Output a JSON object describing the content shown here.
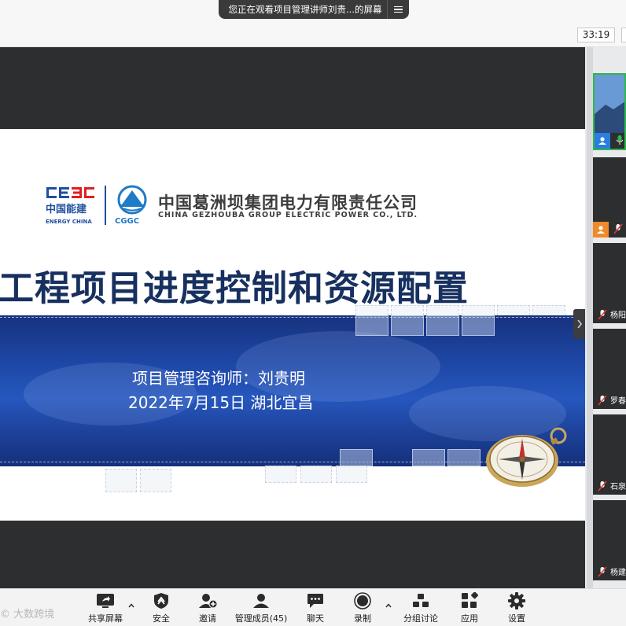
{
  "share_banner": {
    "text": "您正在观看项目管理讲师刘贵...的屏幕"
  },
  "timer": {
    "value": "33:19"
  },
  "slide": {
    "logo_left_text": "中国能建",
    "logo_left_sub": "ENERGY CHINA",
    "logo_right_text": "CGGC",
    "company_cn": "中国葛洲坝集团电力有限责任公司",
    "company_en": "CHINA GEZHOUBA GROUP ELECTRIC POWER CO., LTD.",
    "title": "工程项目进度控制和资源配置",
    "presenter": "项目管理咨询师：刘贵明",
    "date_location": "2022年7月15日 湖北宜昌"
  },
  "participants": [
    {
      "name": "",
      "role": "host",
      "mic": "on",
      "active": true
    },
    {
      "name": "",
      "role": "cohost",
      "mic": "muted",
      "active": false
    },
    {
      "name": "杨阳",
      "role": "",
      "mic": "muted",
      "active": false
    },
    {
      "name": "罗春",
      "role": "",
      "mic": "muted",
      "active": false
    },
    {
      "name": "石泉",
      "role": "",
      "mic": "muted",
      "active": false
    },
    {
      "name": "杨建",
      "role": "",
      "mic": "muted",
      "active": false
    }
  ],
  "toolbar": {
    "share_screen": "共享屏幕",
    "security": "安全",
    "invite": "邀请",
    "manage_members": "管理成员(45)",
    "chat": "聊天",
    "record": "录制",
    "breakout": "分组讨论",
    "apps": "应用",
    "settings": "设置"
  },
  "watermark": {
    "text": "© 大数跨境"
  },
  "colors": {
    "accent_green": "#2eb84d",
    "slide_navy": "#17305f",
    "band_blue": "#1d46a4",
    "host_badge": "#2a7de1",
    "cohost_badge": "#ef8a2a",
    "mute_red": "#e23b3b"
  }
}
